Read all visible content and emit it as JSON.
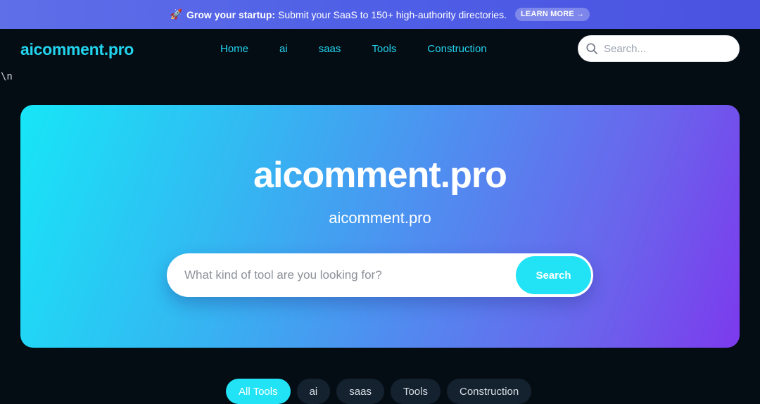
{
  "promo": {
    "icon": "rocket-icon",
    "headline": "Grow your startup:",
    "text": "Submit your SaaS to 150+ high-authority directories.",
    "cta": "LEARN MORE →"
  },
  "header": {
    "logo": "aicomment.pro",
    "nav": [
      "Home",
      "ai",
      "saas",
      "Tools",
      "Construction"
    ],
    "search_placeholder": "Search..."
  },
  "stray_text": "\\n",
  "hero": {
    "title": "aicomment.pro",
    "subtitle": "aicomment.pro",
    "search_placeholder": "What kind of tool are you looking for?",
    "search_button": "Search"
  },
  "filters": {
    "chips": [
      "All Tools",
      "ai",
      "saas",
      "Tools",
      "Construction"
    ],
    "active": "All Tools"
  },
  "colors": {
    "accent": "#22d3ee",
    "background": "#050d14",
    "promo": "#4f5fe6",
    "hero_start": "#17e6f7",
    "hero_end": "#7c3aed"
  }
}
